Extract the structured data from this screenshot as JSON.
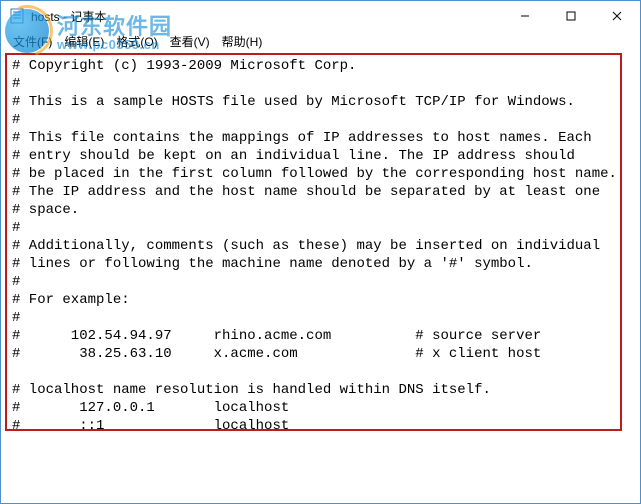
{
  "titlebar": {
    "title": "hosts - 记事本"
  },
  "menubar": {
    "file": "文件(F)",
    "edit": "编辑(E)",
    "format": "格式(O)",
    "view": "查看(V)",
    "help": "帮助(H)"
  },
  "watermark": {
    "cn": "河东软件园",
    "en": "www.pc0359.cn"
  },
  "editor_lines": [
    "# Copyright (c) 1993-2009 Microsoft Corp.",
    "#",
    "# This is a sample HOSTS file used by Microsoft TCP/IP for Windows.",
    "#",
    "# This file contains the mappings of IP addresses to host names. Each",
    "# entry should be kept on an individual line. The IP address should",
    "# be placed in the first column followed by the corresponding host name.",
    "# The IP address and the host name should be separated by at least one",
    "# space.",
    "#",
    "# Additionally, comments (such as these) may be inserted on individual",
    "# lines or following the machine name denoted by a '#' symbol.",
    "#",
    "# For example:",
    "#",
    "#      102.54.94.97     rhino.acme.com          # source server",
    "#       38.25.63.10     x.acme.com              # x client host",
    "",
    "# localhost name resolution is handled within DNS itself.",
    "#       127.0.0.1       localhost",
    "#       ::1             localhost"
  ]
}
